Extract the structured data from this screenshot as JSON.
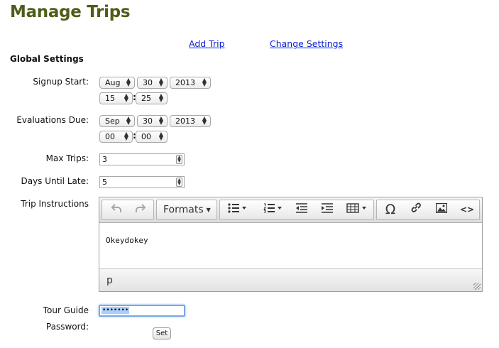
{
  "page": {
    "title": "Manage Trips"
  },
  "nav": {
    "add_trip": "Add Trip",
    "change_settings": "Change Settings"
  },
  "section": {
    "heading": "Global Settings"
  },
  "signup_start": {
    "label": "Signup Start:",
    "month": "Aug",
    "day": "30",
    "year": "2013",
    "hour": "15",
    "minute": "25"
  },
  "evaluations_due": {
    "label": "Evaluations Due:",
    "month": "Sep",
    "day": "30",
    "year": "2013",
    "hour": "00",
    "minute": "00"
  },
  "time_separator": ":",
  "max_trips": {
    "label": "Max Trips:",
    "value": "3"
  },
  "days_until_late": {
    "label": "Days Until Late:",
    "value": "5"
  },
  "trip_instructions": {
    "label": "Trip Instructions",
    "toolbar": {
      "formats_label": "Formats",
      "icons": [
        "undo-icon",
        "redo-icon",
        "bullet-list-icon",
        "numbered-list-icon",
        "outdent-icon",
        "indent-icon",
        "table-icon",
        "special-char-icon",
        "link-icon",
        "image-icon",
        "code-icon"
      ]
    },
    "content": "Okeydokey",
    "status_path": "p"
  },
  "tour_guide_password": {
    "label_line1": "Tour Guide",
    "label_line2": "Password:",
    "masked_value": "•••••••"
  },
  "set_button": {
    "label": "Set"
  },
  "colors": {
    "title": "#4e5d17",
    "link": "#0b1fd0",
    "focus": "#7aa7e3"
  }
}
